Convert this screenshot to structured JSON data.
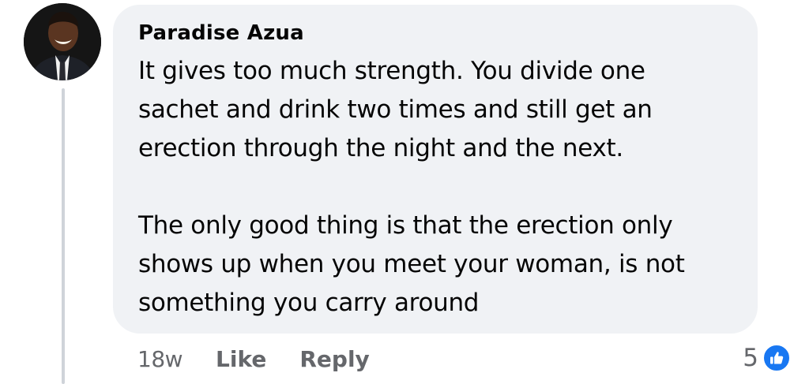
{
  "comment": {
    "author": "Paradise Azua",
    "paragraphs": [
      [
        "It gives too much strength. You divide one",
        "sachet and drink two times and still get an",
        "erection through the night and the next."
      ],
      [
        "The only good thing is that the erection only",
        "shows up when you meet your woman, is not",
        "something you carry around"
      ]
    ]
  },
  "actions": {
    "timestamp": "18w",
    "like_label": "Like",
    "reply_label": "Reply"
  },
  "reactions": {
    "count": "5",
    "icon": "thumbs-up-icon",
    "color": "#1877f2"
  },
  "colors": {
    "bubble": "#f0f2f5",
    "secondary_text": "#65676b",
    "thread_line": "#cfd3d9"
  }
}
